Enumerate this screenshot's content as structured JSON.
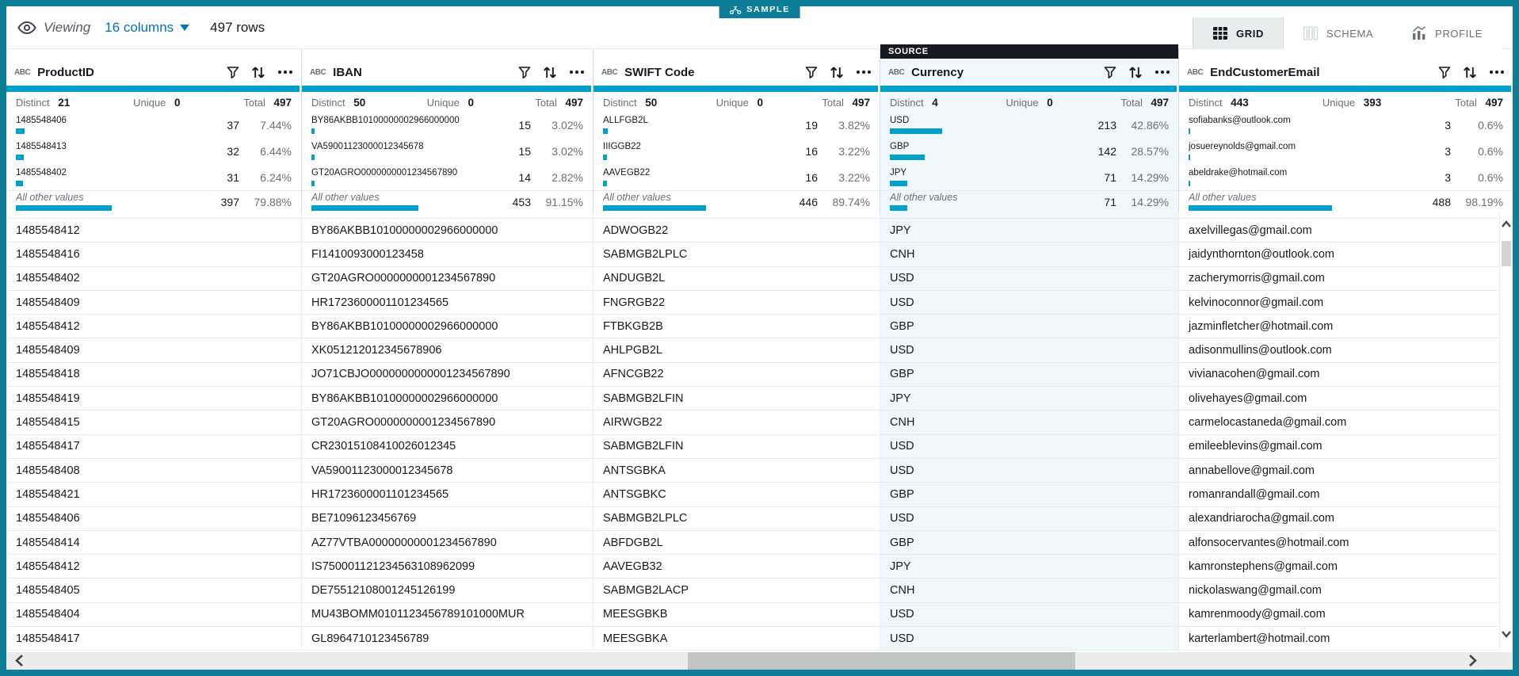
{
  "badge": {
    "label": "SAMPLE"
  },
  "toolbar": {
    "viewing_label": "Viewing",
    "columns_selector": "16 columns",
    "rows_count": "497 rows",
    "tabs": [
      {
        "label": "GRID",
        "active": true
      },
      {
        "label": "SCHEMA",
        "active": false
      },
      {
        "label": "PROFILE",
        "active": false
      }
    ]
  },
  "stats_labels": {
    "distinct": "Distinct",
    "unique": "Unique",
    "total": "Total",
    "all_other": "All other values"
  },
  "accent_colors": {
    "teal_border": "#0c7e98",
    "bar_teal": "#00a1c9",
    "link_blue": "#0073bb",
    "source_tag_bg": "#16191f",
    "highlight_col_bg": "#f1f8fb"
  },
  "columns": [
    {
      "name": "ProductID",
      "type": "ABC",
      "distinct": "21",
      "unique": "0",
      "total": "497",
      "top_values": [
        {
          "label": "1485548406",
          "count": "37",
          "pct": "7.44%"
        },
        {
          "label": "1485548413",
          "count": "32",
          "pct": "6.44%"
        },
        {
          "label": "1485548402",
          "count": "31",
          "pct": "6.24%"
        }
      ],
      "other": {
        "count": "397",
        "pct": "79.88%"
      }
    },
    {
      "name": "IBAN",
      "type": "ABC",
      "distinct": "50",
      "unique": "0",
      "total": "497",
      "top_values": [
        {
          "label": "BY86AKBB10100000002966000000",
          "count": "15",
          "pct": "3.02%"
        },
        {
          "label": "VA59001123000012345678",
          "count": "15",
          "pct": "3.02%"
        },
        {
          "label": "GT20AGRO0000000001234567890",
          "count": "14",
          "pct": "2.82%"
        }
      ],
      "other": {
        "count": "453",
        "pct": "91.15%"
      }
    },
    {
      "name": "SWIFT Code",
      "type": "ABC",
      "distinct": "50",
      "unique": "0",
      "total": "497",
      "top_values": [
        {
          "label": "ALLFGB2L",
          "count": "19",
          "pct": "3.82%"
        },
        {
          "label": "IIIGGB22",
          "count": "16",
          "pct": "3.22%"
        },
        {
          "label": "AAVEGB22",
          "count": "16",
          "pct": "3.22%"
        }
      ],
      "other": {
        "count": "446",
        "pct": "89.74%"
      }
    },
    {
      "name": "Currency",
      "type": "ABC",
      "source_tag": "SOURCE",
      "highlight": true,
      "distinct": "4",
      "unique": "0",
      "total": "497",
      "top_values": [
        {
          "label": "USD",
          "count": "213",
          "pct": "42.86%"
        },
        {
          "label": "GBP",
          "count": "142",
          "pct": "28.57%"
        },
        {
          "label": "JPY",
          "count": "71",
          "pct": "14.29%"
        }
      ],
      "other": {
        "count": "71",
        "pct": "14.29%"
      }
    },
    {
      "name": "EndCustomerEmail",
      "type": "ABC",
      "distinct": "443",
      "unique": "393",
      "total": "497",
      "top_values": [
        {
          "label": "sofiabanks@outlook.com",
          "count": "3",
          "pct": "0.6%"
        },
        {
          "label": "josuereynolds@gmail.com",
          "count": "3",
          "pct": "0.6%"
        },
        {
          "label": "abeldrake@hotmail.com",
          "count": "3",
          "pct": "0.6%"
        }
      ],
      "other": {
        "count": "488",
        "pct": "98.19%"
      }
    }
  ],
  "rows": [
    [
      "1485548412",
      "BY86AKBB10100000002966000000",
      "ADWOGB22",
      "JPY",
      "axelvillegas@gmail.com"
    ],
    [
      "1485548416",
      "FI1410093000123458",
      "SABMGB2LPLC",
      "CNH",
      "jaidynthornton@outlook.com"
    ],
    [
      "1485548402",
      "GT20AGRO0000000001234567890",
      "ANDUGB2L",
      "USD",
      "zacherymorris@gmail.com"
    ],
    [
      "1485548409",
      "HR1723600001101234565",
      "FNGRGB22",
      "USD",
      "kelvinoconnor@gmail.com"
    ],
    [
      "1485548412",
      "BY86AKBB10100000002966000000",
      "FTBKGB2B",
      "GBP",
      "jazminfletcher@hotmail.com"
    ],
    [
      "1485548409",
      "XK051212012345678906",
      "AHLPGB2L",
      "USD",
      "adisonmullins@outlook.com"
    ],
    [
      "1485548418",
      "JO71CBJO0000000000001234567890",
      "AFNCGB22",
      "GBP",
      "vivianacohen@gmail.com"
    ],
    [
      "1485548419",
      "BY86AKBB10100000002966000000",
      "SABMGB2LFIN",
      "JPY",
      "olivehayes@gmail.com"
    ],
    [
      "1485548415",
      "GT20AGRO0000000001234567890",
      "AIRWGB22",
      "CNH",
      "carmelocastaneda@gmail.com"
    ],
    [
      "1485548417",
      "CR23015108410026012345",
      "SABMGB2LFIN",
      "USD",
      "emileeblevins@gmail.com"
    ],
    [
      "1485548408",
      "VA59001123000012345678",
      "ANTSGBKA",
      "USD",
      "annabellove@gmail.com"
    ],
    [
      "1485548421",
      "HR1723600001101234565",
      "ANTSGBKC",
      "GBP",
      "romanrandall@gmail.com"
    ],
    [
      "1485548406",
      "BE71096123456769",
      "SABMGB2LPLC",
      "USD",
      "alexandriarocha@gmail.com"
    ],
    [
      "1485548414",
      "AZ77VTBA00000000001234567890",
      "ABFDGB2L",
      "GBP",
      "alfonsocervantes@hotmail.com"
    ],
    [
      "1485548412",
      "IS750001121234563108962099",
      "AAVEGB32",
      "JPY",
      "kamronstephens@gmail.com"
    ],
    [
      "1485548405",
      "DE75512108001245126199",
      "SABMGB2LACP",
      "CNH",
      "nickolaswang@gmail.com"
    ],
    [
      "1485548404",
      "MU43BOMM0101123456789101000MUR",
      "MEESGBKB",
      "USD",
      "kamrenmoody@gmail.com"
    ],
    [
      "1485548417",
      "GL8964710123456789",
      "MEESGBKA",
      "USD",
      "karterlambert@hotmail.com"
    ]
  ]
}
